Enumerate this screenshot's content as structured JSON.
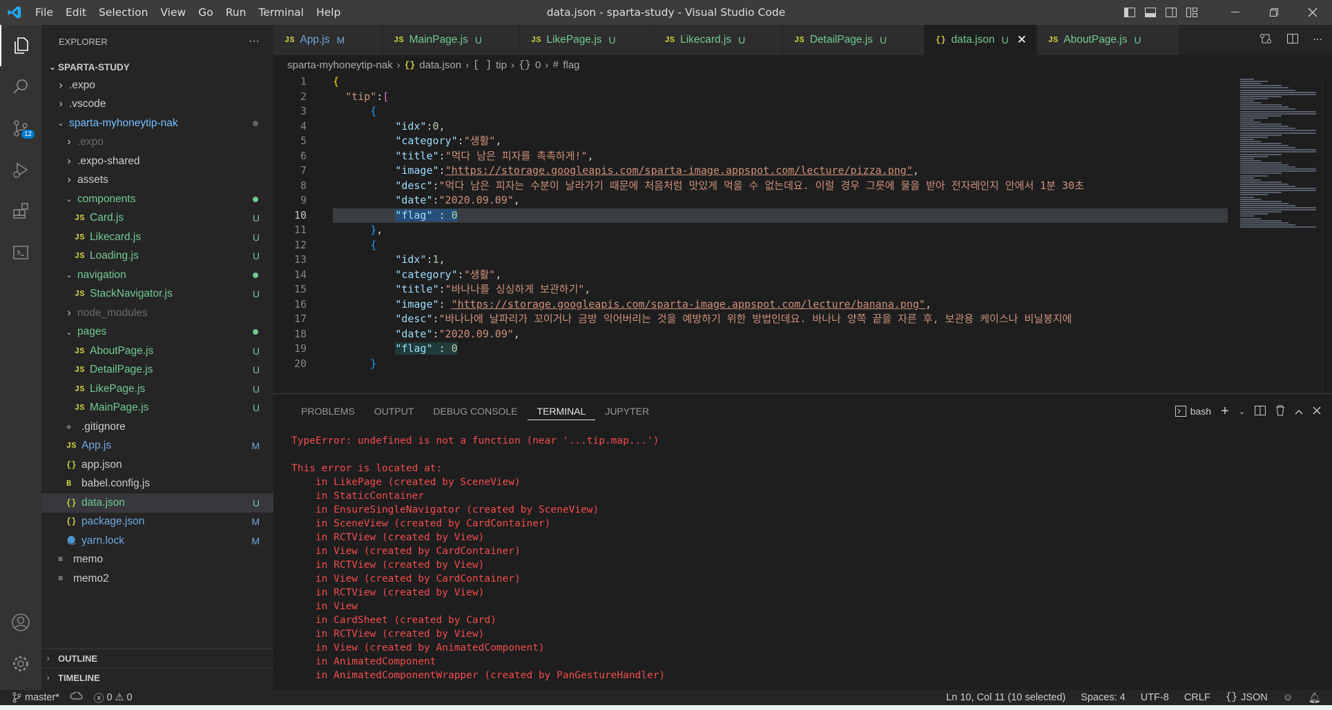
{
  "window": {
    "title": "data.json - sparta-study - Visual Studio Code",
    "menu": [
      "File",
      "Edit",
      "Selection",
      "View",
      "Go",
      "Run",
      "Terminal",
      "Help"
    ]
  },
  "activity": {
    "scm_badge": "12"
  },
  "explorer": {
    "header": "EXPLORER",
    "more": "···",
    "root": "SPARTA-STUDY",
    "items": [
      {
        "label": ".expo",
        "type": "folder",
        "depth": 1,
        "collapsed": true,
        "color": "#cccccc"
      },
      {
        "label": ".vscode",
        "type": "folder",
        "depth": 1,
        "collapsed": true,
        "color": "#cccccc"
      },
      {
        "label": "sparta-myhoneytip-nak",
        "type": "folder",
        "depth": 1,
        "collapsed": false,
        "color": "#75beff",
        "dot": "#616161"
      },
      {
        "label": ".expo",
        "type": "folder",
        "depth": 2,
        "collapsed": true,
        "color": "#6b6b6b"
      },
      {
        "label": ".expo-shared",
        "type": "folder",
        "depth": 2,
        "collapsed": true,
        "color": "#cccccc"
      },
      {
        "label": "assets",
        "type": "folder",
        "depth": 2,
        "collapsed": true,
        "color": "#cccccc"
      },
      {
        "label": "components",
        "type": "folder",
        "depth": 2,
        "collapsed": false,
        "color": "#73c991",
        "dot": "#73c991"
      },
      {
        "label": "Card.js",
        "type": "js",
        "depth": 3,
        "color": "#73c991",
        "status": "U"
      },
      {
        "label": "Likecard.js",
        "type": "js",
        "depth": 3,
        "color": "#73c991",
        "status": "U"
      },
      {
        "label": "Loading.js",
        "type": "js",
        "depth": 3,
        "color": "#73c991",
        "status": "U"
      },
      {
        "label": "navigation",
        "type": "folder",
        "depth": 2,
        "collapsed": false,
        "color": "#73c991",
        "dot": "#73c991"
      },
      {
        "label": "StackNavigator.js",
        "type": "js",
        "depth": 3,
        "color": "#73c991",
        "status": "U"
      },
      {
        "label": "node_modules",
        "type": "folder",
        "depth": 2,
        "collapsed": true,
        "color": "#6b6b6b"
      },
      {
        "label": "pages",
        "type": "folder",
        "depth": 2,
        "collapsed": false,
        "color": "#73c991",
        "dot": "#73c991"
      },
      {
        "label": "AboutPage.js",
        "type": "js",
        "depth": 3,
        "color": "#73c991",
        "status": "U"
      },
      {
        "label": "DetailPage.js",
        "type": "js",
        "depth": 3,
        "color": "#73c991",
        "status": "U"
      },
      {
        "label": "LikePage.js",
        "type": "js",
        "depth": 3,
        "color": "#73c991",
        "status": "U"
      },
      {
        "label": "MainPage.js",
        "type": "js",
        "depth": 3,
        "color": "#73c991",
        "status": "U"
      },
      {
        "label": ".gitignore",
        "type": "git",
        "depth": 2,
        "color": "#cccccc"
      },
      {
        "label": "App.js",
        "type": "js",
        "depth": 2,
        "color": "#6fa8dc",
        "status": "M"
      },
      {
        "label": "app.json",
        "type": "json",
        "depth": 2,
        "color": "#cccccc"
      },
      {
        "label": "babel.config.js",
        "type": "babel",
        "depth": 2,
        "color": "#cccccc"
      },
      {
        "label": "data.json",
        "type": "json",
        "depth": 2,
        "color": "#73c991",
        "status": "U",
        "selected": true
      },
      {
        "label": "package.json",
        "type": "json",
        "depth": 2,
        "color": "#6fa8dc",
        "status": "M"
      },
      {
        "label": "yarn.lock",
        "type": "yarn",
        "depth": 2,
        "color": "#6fa8dc",
        "status": "M"
      },
      {
        "label": "memo",
        "type": "text",
        "depth": 1,
        "color": "#cccccc"
      },
      {
        "label": "memo2",
        "type": "text",
        "depth": 1,
        "color": "#cccccc"
      }
    ],
    "outline": "OUTLINE",
    "timeline": "TIMELINE"
  },
  "tabs": [
    {
      "icon": "JS",
      "label": "App.js",
      "status": "M",
      "color": "#6fa8dc",
      "active": false
    },
    {
      "icon": "JS",
      "label": "MainPage.js",
      "status": "U",
      "color": "#73c991",
      "active": false
    },
    {
      "icon": "JS",
      "label": "LikePage.js",
      "status": "U",
      "color": "#73c991",
      "active": false
    },
    {
      "icon": "JS",
      "label": "Likecard.js",
      "status": "U",
      "color": "#73c991",
      "active": false
    },
    {
      "icon": "JS",
      "label": "DetailPage.js",
      "status": "U",
      "color": "#73c991",
      "active": false
    },
    {
      "icon": "{}",
      "label": "data.json",
      "status": "U",
      "color": "#73c991",
      "active": true,
      "close": "✕"
    },
    {
      "icon": "JS",
      "label": "AboutPage.js",
      "status": "U",
      "color": "#73c991",
      "active": false
    }
  ],
  "breadcrumb": {
    "folder": "sparta-myhoneytip-nak",
    "file": "data.json",
    "arr": "tip",
    "obj": "0",
    "key": "flag"
  },
  "editor": {
    "current_line": 10,
    "line_numbers": [
      "1",
      "2",
      "3",
      "4",
      "5",
      "6",
      "7",
      "8",
      "9",
      "10",
      "11",
      "12",
      "13",
      "14",
      "15",
      "16",
      "17",
      "18",
      "19",
      "20"
    ],
    "lines": {
      "l5_val": "\"생활\"",
      "l6_val": "\"먹다 남은 피자를 촉촉하게!\"",
      "l7_val": "\"https://storage.googleapis.com/sparta-image.appspot.com/lecture/pizza.png\"",
      "l8_val": "\"먹다 남은 피자는 수분이 날라가기 때문에 처음처럼 맛있게 먹을 수 없는데요. 이럴 경우 그릇에 물을 받아 전자레인지 안에서 1분 30초",
      "l9_val": "\"2020.09.09\"",
      "l14_val": "\"생활\"",
      "l15_val": "\"바나나를 싱싱하게 보관하기\"",
      "l16_val": "\"https://storage.googleapis.com/sparta-image.appspot.com/lecture/banana.png\"",
      "l17_val": "\"바나나에 날파리가 꼬이거나 금방 익어버리는 것을 예방하기 위한 방법인데요. 바나나 양쪽 끝을 자른 후, 보관용 케이스나 비닐봉지에",
      "l18_val": "\"2020.09.09\""
    }
  },
  "panel": {
    "tabs": [
      "PROBLEMS",
      "OUTPUT",
      "DEBUG CONSOLE",
      "TERMINAL",
      "JUPYTER"
    ],
    "active_tab": "TERMINAL",
    "shell": "bash",
    "terminal_lines": [
      "TypeError: undefined is not a function (near '...tip.map...')",
      "",
      "This error is located at:",
      "    in LikePage (created by SceneView)",
      "    in StaticContainer",
      "    in EnsureSingleNavigator (created by SceneView)",
      "    in SceneView (created by CardContainer)",
      "    in RCTView (created by View)",
      "    in View (created by CardContainer)",
      "    in RCTView (created by View)",
      "    in View (created by CardContainer)",
      "    in RCTView (created by View)",
      "    in View",
      "    in CardSheet (created by Card)",
      "    in RCTView (created by View)",
      "    in View (created by AnimatedComponent)",
      "    in AnimatedComponent",
      "    in AnimatedComponentWrapper (created by PanGestureHandler)"
    ]
  },
  "status": {
    "branch": "master*",
    "errors": "0",
    "warnings": "0",
    "position": "Ln 10, Col 11 (10 selected)",
    "spaces": "Spaces: 4",
    "encoding": "UTF-8",
    "eol": "CRLF",
    "language": "JSON"
  }
}
